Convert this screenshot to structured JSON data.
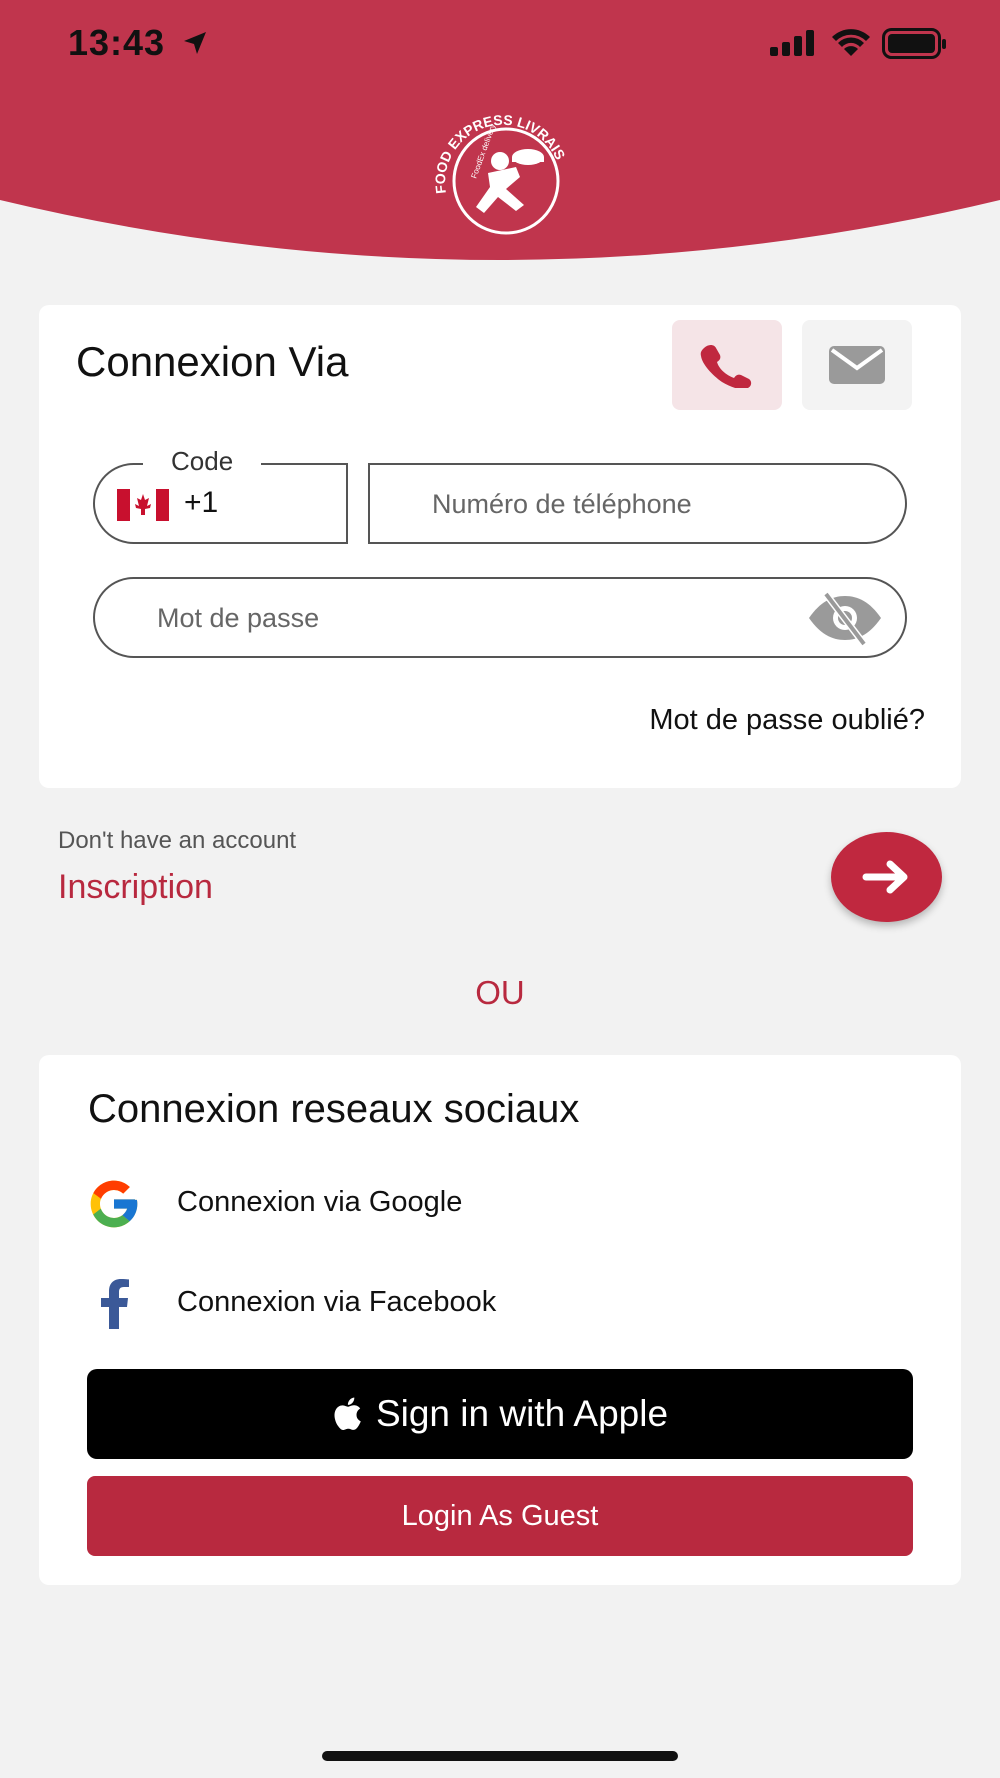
{
  "status_bar": {
    "time": "13:43"
  },
  "header": {
    "logo_text": "FOOD EXPRESS LIVRAISON",
    "logo_subtext": "FoodEx delivery",
    "brand_color": "#c0354d"
  },
  "login": {
    "title": "Connexion Via",
    "phone_tab_icon": "phone-icon",
    "email_tab_icon": "mail-icon",
    "code_label": "Code",
    "country_flag": "canada-flag",
    "dial_code": "+1",
    "phone_placeholder": "Numéro de téléphone",
    "password_placeholder": "Mot de passe",
    "forgot_password": "Mot de passe oublié?"
  },
  "signup": {
    "prompt": "Don't have an account",
    "link": "Inscription",
    "go_icon": "arrow-right-icon"
  },
  "separator": "OU",
  "social": {
    "title": "Connexion reseaux sociaux",
    "google_label": "Connexion via Google",
    "facebook_label": "Connexion via Facebook",
    "apple_label": "Sign in with Apple",
    "guest_label": "Login As Guest"
  },
  "colors": {
    "accent": "#b8293f",
    "background": "#f2f2f2",
    "card": "#ffffff"
  }
}
